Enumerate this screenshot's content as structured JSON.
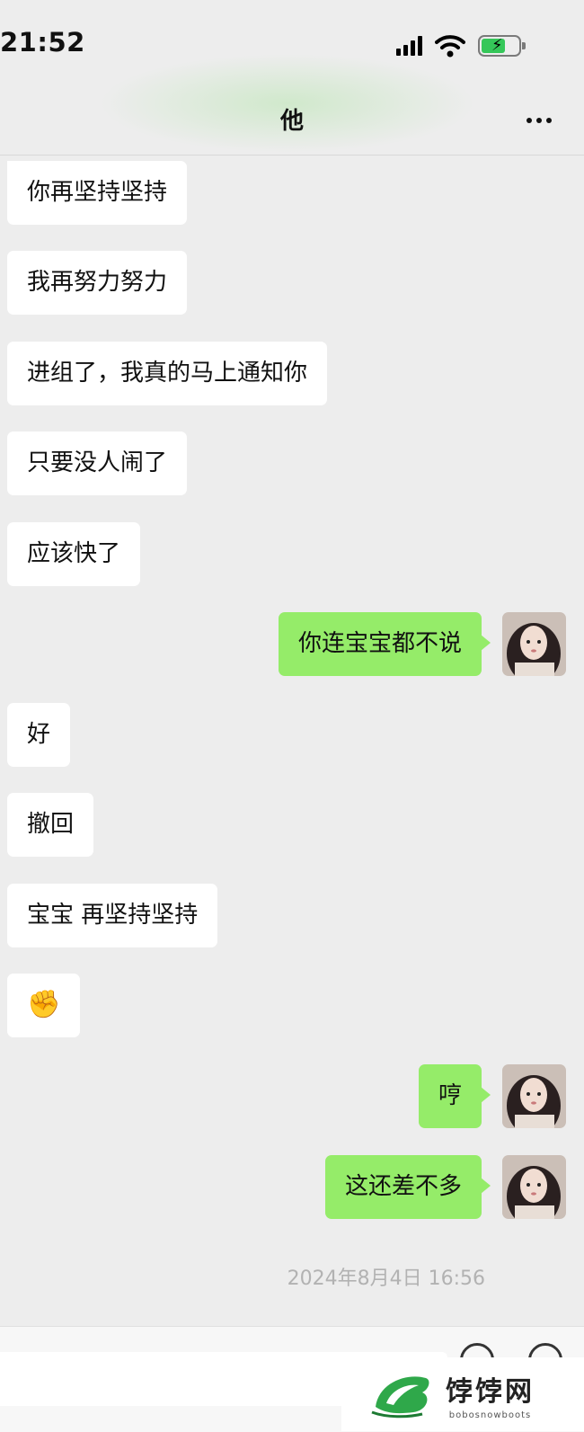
{
  "status_bar": {
    "time": "21:52"
  },
  "nav": {
    "title": "他"
  },
  "messages": [
    {
      "dir": "in",
      "text": "你再坚持坚持"
    },
    {
      "dir": "in",
      "text": "我再努力努力"
    },
    {
      "dir": "in",
      "text": "进组了，我真的马上通知你"
    },
    {
      "dir": "in",
      "text": "只要没人闹了"
    },
    {
      "dir": "in",
      "text": "应该快了"
    },
    {
      "dir": "out",
      "text": "你连宝宝都不说"
    },
    {
      "dir": "in",
      "text": "好"
    },
    {
      "dir": "in",
      "text": "撤回"
    },
    {
      "dir": "in",
      "text": "宝宝 再坚持坚持"
    },
    {
      "dir": "in",
      "text": "✊"
    },
    {
      "dir": "out",
      "text": "哼"
    },
    {
      "dir": "out",
      "text": "这还差不多"
    }
  ],
  "timestamp": "2024年8月4日 16:56",
  "watermark": {
    "title": "饽饽网",
    "subtitle": "bobosnowboots"
  },
  "colors": {
    "outgoing_bubble": "#95ec69",
    "incoming_bubble": "#ffffff",
    "background": "#ededed"
  }
}
